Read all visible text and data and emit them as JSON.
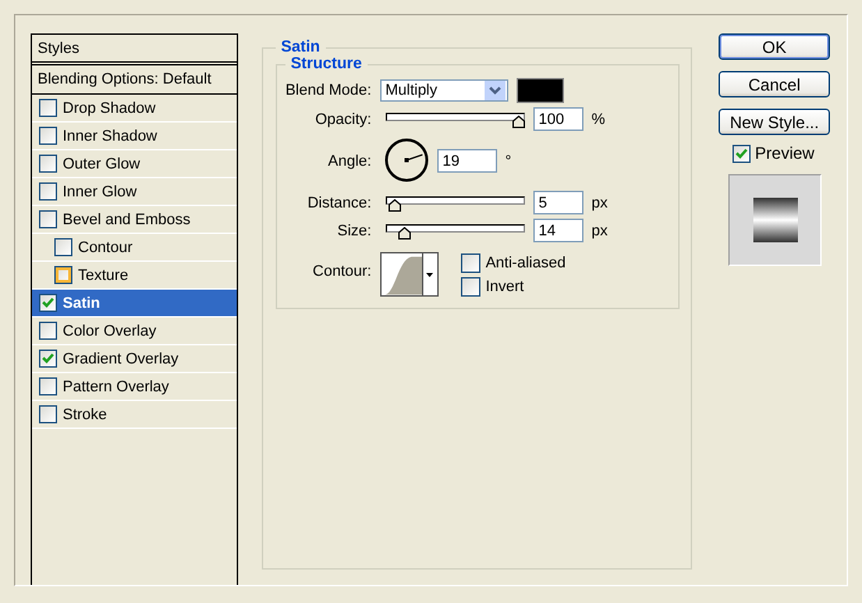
{
  "styles_panel": {
    "header": "Styles",
    "blending_options": "Blending Options: Default",
    "items": [
      {
        "label": "Drop Shadow",
        "checked": false,
        "selected": false,
        "hovered": false
      },
      {
        "label": "Inner Shadow",
        "checked": false,
        "selected": false,
        "hovered": false
      },
      {
        "label": "Outer Glow",
        "checked": false,
        "selected": false,
        "hovered": false
      },
      {
        "label": "Inner Glow",
        "checked": false,
        "selected": false,
        "hovered": false
      },
      {
        "label": "Bevel and Emboss",
        "checked": false,
        "selected": false,
        "hovered": false,
        "children": [
          {
            "label": "Contour",
            "checked": false,
            "selected": false,
            "hovered": false
          },
          {
            "label": "Texture",
            "checked": false,
            "selected": false,
            "hovered": true
          }
        ]
      },
      {
        "label": "Satin",
        "checked": true,
        "selected": true,
        "hovered": false
      },
      {
        "label": "Color Overlay",
        "checked": false,
        "selected": false,
        "hovered": false
      },
      {
        "label": "Gradient Overlay",
        "checked": true,
        "selected": false,
        "hovered": false
      },
      {
        "label": "Pattern Overlay",
        "checked": false,
        "selected": false,
        "hovered": false
      },
      {
        "label": "Stroke",
        "checked": false,
        "selected": false,
        "hovered": false
      }
    ]
  },
  "satin": {
    "title": "Satin",
    "structure": {
      "title": "Structure",
      "blend_mode": {
        "label": "Blend Mode:",
        "value": "Multiply",
        "color": "#000000"
      },
      "opacity": {
        "label": "Opacity:",
        "level": 1,
        "value": "100",
        "unit": "%"
      },
      "angle": {
        "label": "Angle:",
        "value": "19",
        "unit": "°"
      },
      "distance": {
        "label": "Distance:",
        "level": 0.02,
        "value": "5",
        "unit": "px"
      },
      "size": {
        "label": "Size:",
        "level": 0.1,
        "value": "14",
        "unit": "px"
      },
      "contour": {
        "label": "Contour:"
      },
      "options": [
        {
          "label": "Anti-aliased",
          "checked": false
        },
        {
          "label": "Invert",
          "checked": false
        }
      ]
    }
  },
  "buttons": [
    {
      "label": "OK",
      "default": true
    },
    {
      "label": "Cancel",
      "default": false
    },
    {
      "label": "New Style...",
      "default": false
    }
  ],
  "preview": {
    "label": "Preview",
    "checked": true
  }
}
